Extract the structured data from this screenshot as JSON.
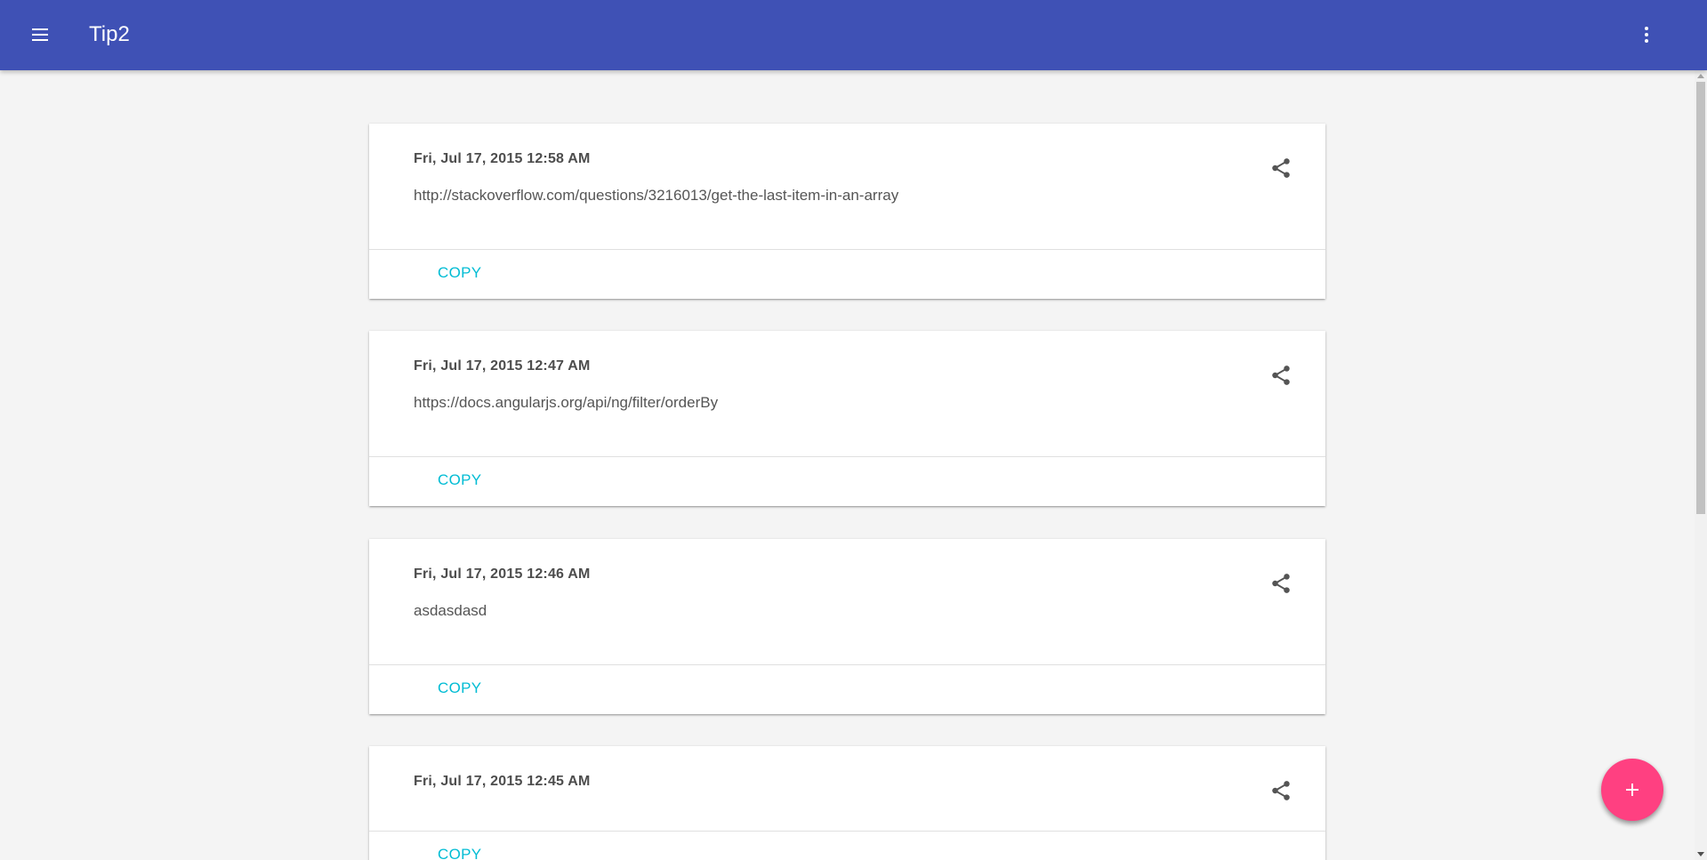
{
  "app": {
    "title": "Tip2",
    "primary_color": "#3f51b5",
    "accent_color": "#ff4081",
    "action_color": "#00bcd4",
    "menu_icon": "menu-icon",
    "more_icon": "more-vert-icon"
  },
  "cards": [
    {
      "date": "Fri, Jul 17, 2015 12:58 AM",
      "text": "http://stackoverflow.com/questions/3216013/get-the-last-item-in-an-array",
      "action_label": "COPY",
      "share_icon": "share-icon"
    },
    {
      "date": "Fri, Jul 17, 2015 12:47 AM",
      "text": "https://docs.angularjs.org/api/ng/filter/orderBy",
      "action_label": "COPY",
      "share_icon": "share-icon"
    },
    {
      "date": "Fri, Jul 17, 2015 12:46 AM",
      "text": "asdasdasd",
      "action_label": "COPY",
      "share_icon": "share-icon"
    },
    {
      "date": "Fri, Jul 17, 2015 12:45 AM",
      "text": "",
      "action_label": "COPY",
      "share_icon": "share-icon"
    }
  ],
  "fab": {
    "icon": "add-icon"
  }
}
